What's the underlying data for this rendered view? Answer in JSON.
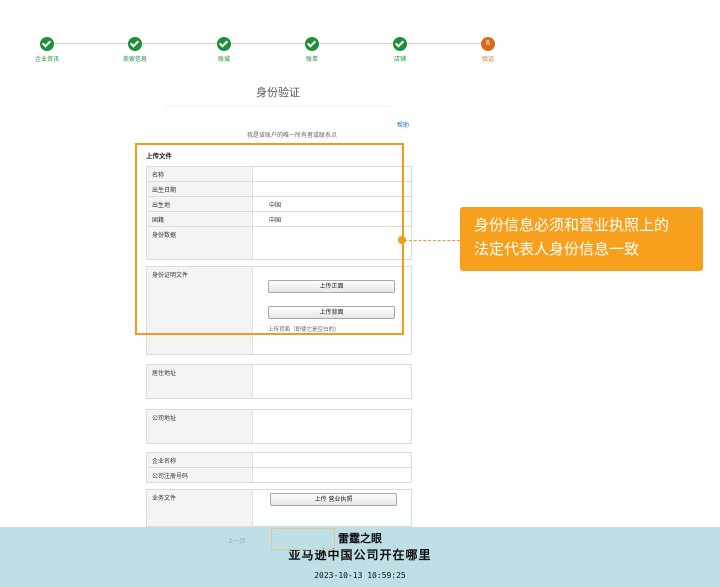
{
  "steps": [
    {
      "label": "企业资讯",
      "state": "done"
    },
    {
      "label": "卖家信息",
      "state": "done"
    },
    {
      "label": "账城",
      "state": "done"
    },
    {
      "label": "账单",
      "state": "done"
    },
    {
      "label": "店铺",
      "state": "done"
    },
    {
      "label": "验证",
      "state": "current",
      "number": "6"
    }
  ],
  "page_title": "身份验证",
  "help_link": "帮助",
  "subtitle": "我是该账户的唯一所有者或联系点",
  "upload_section": {
    "title": "上传文件",
    "fields": [
      {
        "label": "名称",
        "value": ""
      },
      {
        "label": "出生日期",
        "value": ""
      },
      {
        "label": "出生地",
        "value": "中国"
      },
      {
        "label": "国籍",
        "value": "中国"
      },
      {
        "label": "身份数据",
        "value": ""
      }
    ],
    "id_doc_label": "身份证明文件",
    "upload_front": "上传正面",
    "upload_back": "上传背面",
    "back_note": "上传背面（即使它是空白的）"
  },
  "residential_address_label": "居住地址",
  "company_address_label": "公司地址",
  "company_name_label": "企业名称",
  "company_reg_label": "公司注册号码",
  "business_doc_label": "业务文件",
  "upload_business_license": "上传 营业执照",
  "prev_button": "上一页",
  "callout": {
    "line1": "身份信息必须和营业执照上的",
    "line2": "法定代表人身份信息一致"
  },
  "watermark": {
    "line1": "雷霆之眼",
    "line2": "亚马逊中国公司开在哪里",
    "timestamp": "2023-10-13 10:59:25"
  },
  "colors": {
    "done_green": "#1f8f3a",
    "current_orange": "#d86a1c",
    "highlight_orange": "#f39a1c",
    "footer_blue": "#bfdfe7"
  }
}
